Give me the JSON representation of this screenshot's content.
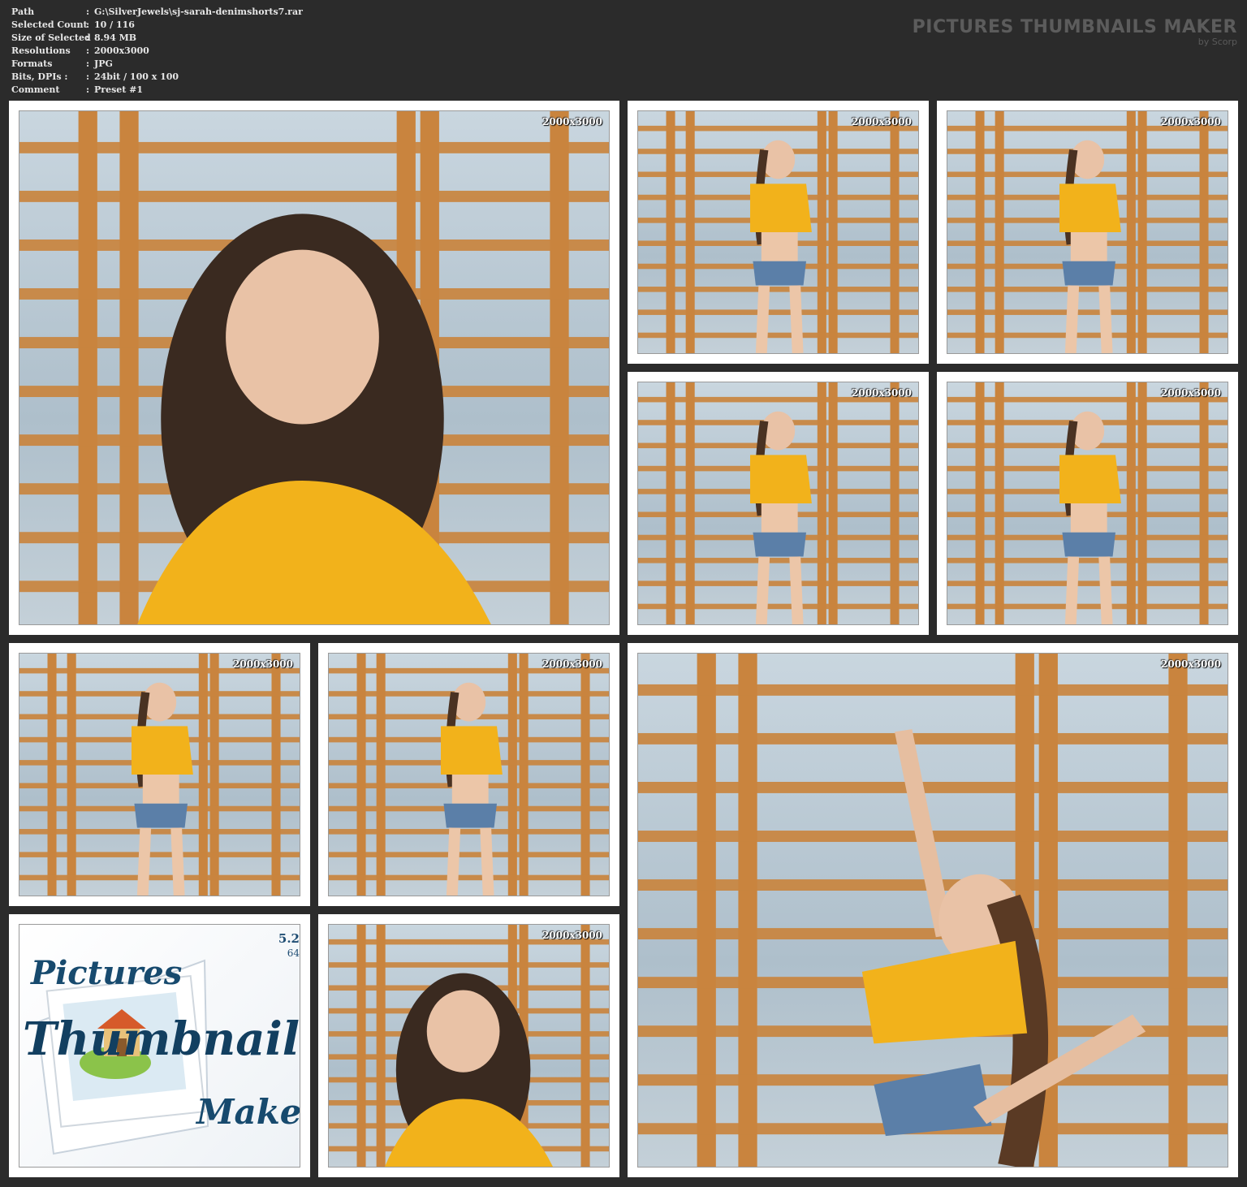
{
  "info": {
    "rows": [
      {
        "key": "Path",
        "value": "G:\\SilverJewels\\sj-sarah-denimshorts7.rar"
      },
      {
        "key": "Selected Count",
        "value": "10 / 116"
      },
      {
        "key": "Size of Selected",
        "value": "8.94 MB"
      },
      {
        "key": "Resolutions",
        "value": "2000x3000"
      },
      {
        "key": "Formats",
        "value": "JPG"
      },
      {
        "key": "Bits, DPIs :",
        "value": "24bit / 100 x 100"
      },
      {
        "key": "Comment",
        "value": "Preset #1"
      }
    ],
    "separator": ":"
  },
  "brand": {
    "title": "PICTURES THUMBNAILS MAKER",
    "subtitle": "by Scorp"
  },
  "thumbnails": [
    {
      "resolution": "2000x3000"
    },
    {
      "resolution": "2000x3000"
    },
    {
      "resolution": "2000x3000"
    },
    {
      "resolution": "2000x3000"
    },
    {
      "resolution": "2000x3000"
    },
    {
      "resolution": "2000x3000"
    },
    {
      "resolution": "2000x3000"
    },
    {
      "resolution": "2000x3000"
    },
    {
      "resolution": "2000x3000"
    }
  ],
  "logo": {
    "version": "5.2",
    "bits": "64",
    "word1": "Pictures",
    "word2": "Thumbnail",
    "word3": "Maker"
  },
  "colors": {
    "background": "#2b2b2b",
    "frame": "#ffffff",
    "bars": "#c9843e",
    "shirt": "#f2b21b",
    "shorts": "#5b7fa8"
  }
}
